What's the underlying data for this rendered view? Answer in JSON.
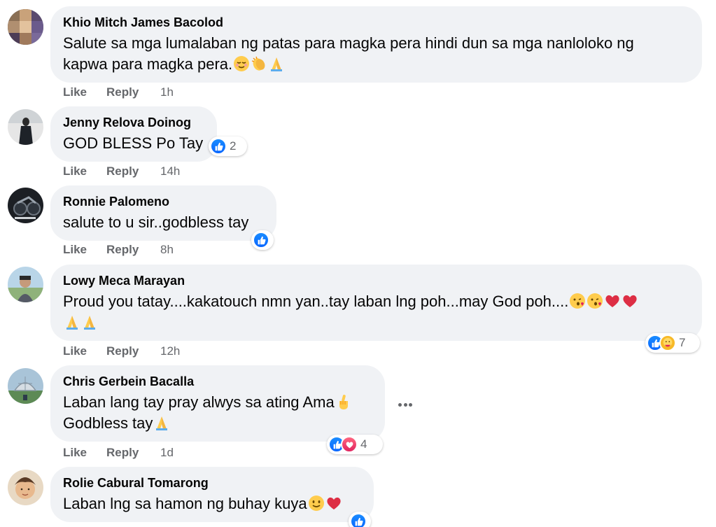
{
  "comments": [
    {
      "author": "Khio Mitch James Bacolod",
      "lines": [
        "Salute sa mga lumalaban ng patas para magka pera hindi dun sa mga nanloloko ng",
        "kapwa para magka pera."
      ],
      "like": "Like",
      "reply": "Reply",
      "time": "1h"
    },
    {
      "author": "Jenny Relova Doinog",
      "lines": [
        "GOD BLESS Po Tay"
      ],
      "like": "Like",
      "reply": "Reply",
      "time": "14h",
      "reaction_count": "2"
    },
    {
      "author": "Ronnie Palomeno",
      "lines": [
        "salute to u sir..godbless tay"
      ],
      "like": "Like",
      "reply": "Reply",
      "time": "8h"
    },
    {
      "author": "Lowy Meca Marayan",
      "lines": [
        "Proud you tatay....kakatouch nmn yan..tay laban lng poh...may God poh....",
        ""
      ],
      "like": "Like",
      "reply": "Reply",
      "time": "12h",
      "reaction_count": "7"
    },
    {
      "author": "Chris Gerbein Bacalla",
      "lines": [
        "Laban lang tay pray alwys sa ating Ama",
        "Godbless tay"
      ],
      "like": "Like",
      "reply": "Reply",
      "time": "1d",
      "reaction_count": "4"
    },
    {
      "author": "Rolie Cabural Tomarong",
      "lines": [
        "Laban lng sa hamon ng buhay kuya"
      ],
      "like": "Like",
      "reply": "Reply",
      "time": ""
    }
  ],
  "icons": {
    "like": "thumbs-up-icon",
    "love": "heart-icon",
    "care": "care-icon",
    "more": "more-options-icon"
  },
  "colors": {
    "bubble": "#f0f2f5",
    "like_blue": "#0866ff",
    "meta_gray": "#65676b"
  }
}
